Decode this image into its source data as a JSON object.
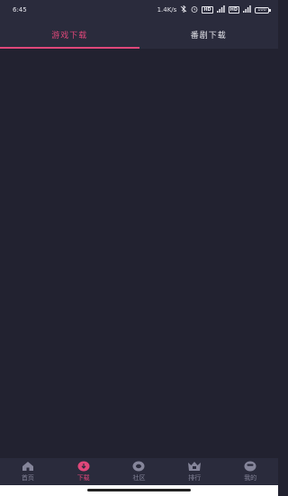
{
  "status_bar": {
    "time": "6:45",
    "network_speed": "1.4K/s",
    "battery_level": "100"
  },
  "tabs": [
    {
      "label": "游戏下载",
      "active": true
    },
    {
      "label": "番剧下载",
      "active": false
    }
  ],
  "bottom_nav": [
    {
      "label": "首页",
      "icon": "home-icon",
      "active": false
    },
    {
      "label": "下载",
      "icon": "download-icon",
      "active": true
    },
    {
      "label": "社区",
      "icon": "community-icon",
      "active": false
    },
    {
      "label": "排行",
      "icon": "crown-icon",
      "active": false
    },
    {
      "label": "我的",
      "icon": "profile-icon",
      "active": false
    }
  ],
  "colors": {
    "background": "#222230",
    "bar_background": "#2a2b3c",
    "accent": "#e0477a",
    "inactive_nav": "#85859a"
  }
}
